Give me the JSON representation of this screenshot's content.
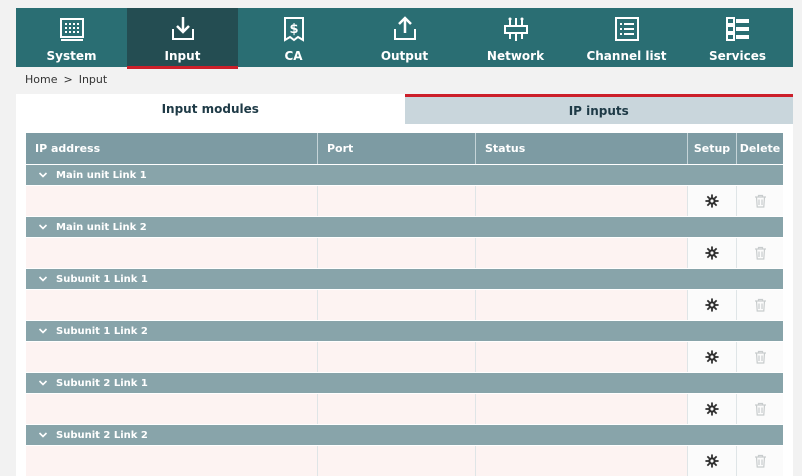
{
  "nav": {
    "items": [
      {
        "label": "System",
        "icon": "system-icon"
      },
      {
        "label": "Input",
        "icon": "input-icon",
        "active": true
      },
      {
        "label": "CA",
        "icon": "ca-icon"
      },
      {
        "label": "Output",
        "icon": "output-icon"
      },
      {
        "label": "Network",
        "icon": "network-icon"
      },
      {
        "label": "Channel list",
        "icon": "channel-list-icon"
      },
      {
        "label": "Services",
        "icon": "services-icon"
      }
    ]
  },
  "breadcrumb": {
    "home": "Home",
    "separator": ">",
    "current": "Input"
  },
  "tabs": [
    {
      "label": "Input modules",
      "active": true
    },
    {
      "label": "IP inputs",
      "active": false
    }
  ],
  "table": {
    "headers": {
      "ip": "IP address",
      "port": "Port",
      "status": "Status",
      "setup": "Setup",
      "delete": "Delete"
    },
    "groups": [
      {
        "label": "Main unit Link 1"
      },
      {
        "label": "Main unit Link 2"
      },
      {
        "label": "Subunit 1 Link 1"
      },
      {
        "label": "Subunit 1 Link 2"
      },
      {
        "label": "Subunit 2 Link 1"
      },
      {
        "label": "Subunit 2 Link 2"
      }
    ]
  },
  "colors": {
    "nav_bg": "#2a6e73",
    "accent": "#cc1f2a",
    "header_bg": "#7d9ba3",
    "group_bg": "#88a4aa",
    "row_bg": "#fdf3f2"
  }
}
